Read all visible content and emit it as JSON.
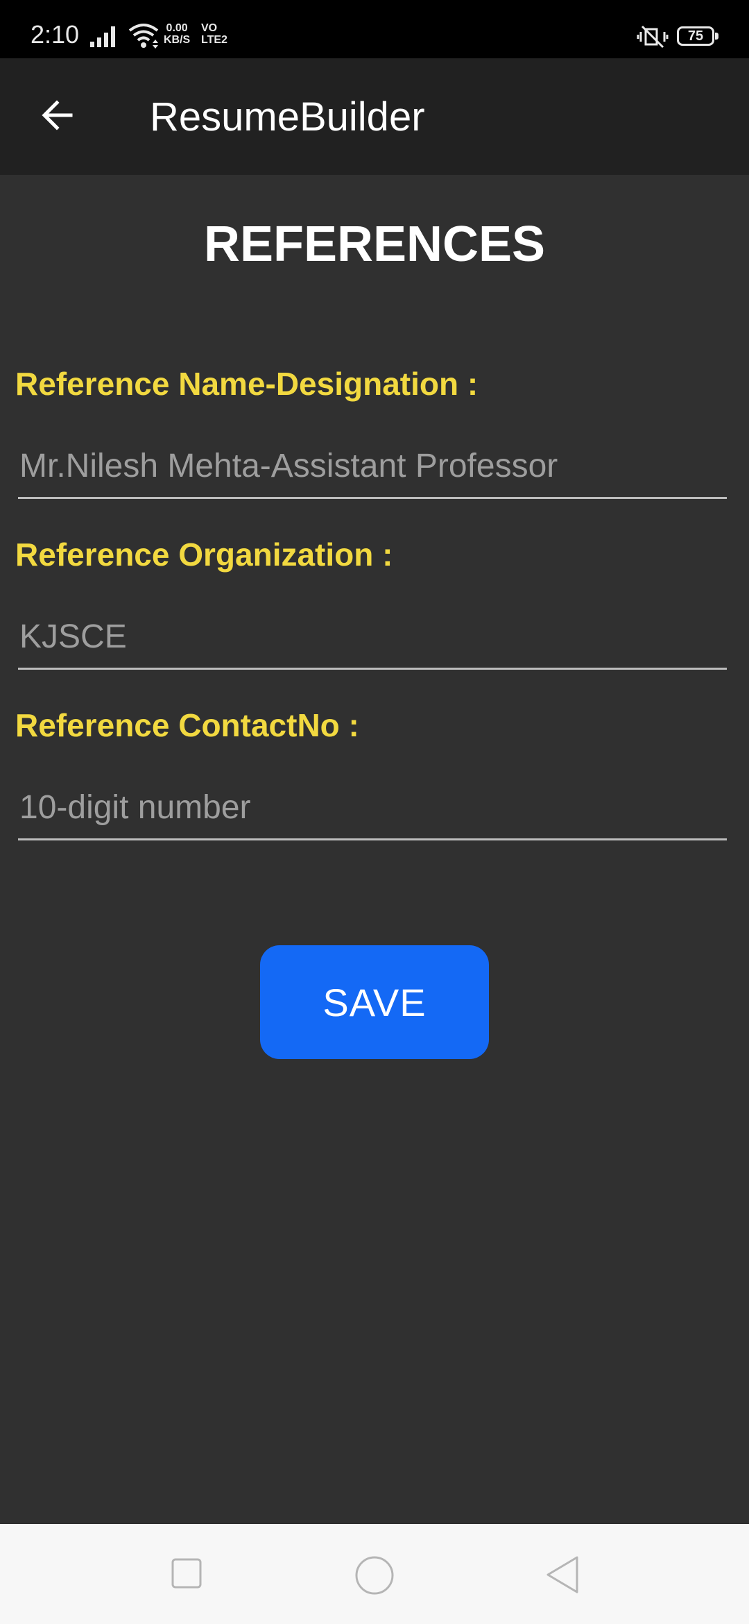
{
  "status_bar": {
    "time": "2:10",
    "net_speed_value": "0.00",
    "net_speed_unit": "KB/S",
    "volte_line1": "VO",
    "volte_line2": "LTE2",
    "battery": "75"
  },
  "app_bar": {
    "title": "ResumeBuilder"
  },
  "page": {
    "title": "REFERENCES"
  },
  "form": {
    "name_label": "Reference Name-Designation :",
    "name_placeholder": "Mr.Nilesh Mehta-Assistant Professor",
    "name_value": "",
    "org_label": "Reference Organization :",
    "org_placeholder": "KJSCE",
    "org_value": "",
    "contact_label": "Reference ContactNo :",
    "contact_placeholder": "10-digit number",
    "contact_value": "",
    "save_label": "SAVE"
  },
  "colors": {
    "background": "#303030",
    "app_bar": "#212121",
    "label": "#f2d940",
    "button": "#1469f5"
  },
  "icons": [
    "back-arrow-icon",
    "signal-icon",
    "wifi-icon",
    "mute-icon",
    "recents-icon",
    "home-icon",
    "nav-back-icon"
  ]
}
